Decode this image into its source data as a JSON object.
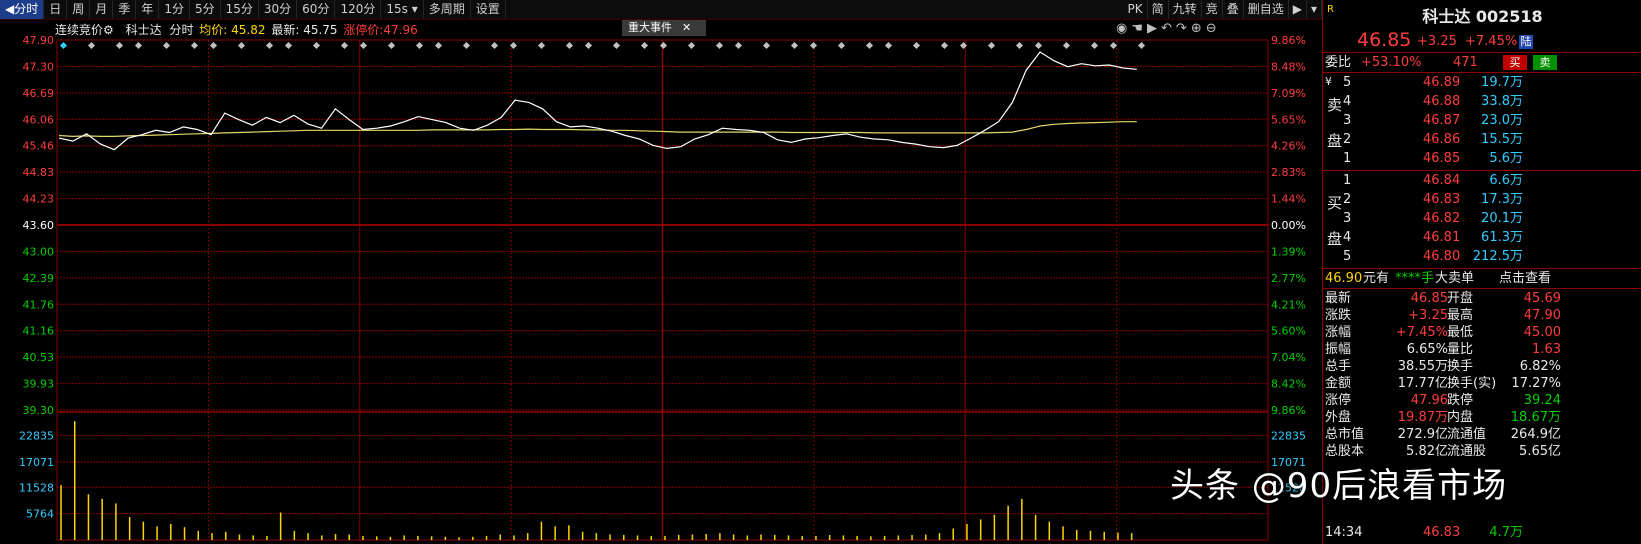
{
  "toolbar": {
    "periods": [
      "分时",
      "日",
      "周",
      "月",
      "季",
      "年",
      "1分",
      "5分",
      "15分",
      "30分",
      "60分",
      "120分",
      "15s",
      "多周期",
      "设置"
    ],
    "right_items": [
      "PK",
      "简",
      "九转",
      "竞",
      "叠",
      "删自选"
    ]
  },
  "header": {
    "auction_label": "连续竞价",
    "name": "科士达",
    "mode": "分时",
    "avg_text": "均价: 45.82",
    "last_text": "最新: 45.75",
    "limit_text": "涨停价:47.96",
    "event_label": "重大事件"
  },
  "axes": {
    "left_prices": [
      "47.90",
      "47.30",
      "46.69",
      "46.06",
      "45.46",
      "44.83",
      "44.23",
      "43.60",
      "43.00",
      "42.39",
      "41.76",
      "41.16",
      "40.53",
      "39.93",
      "39.30"
    ],
    "right_pcts": [
      "9.86%",
      "8.48%",
      "7.09%",
      "5.65%",
      "4.26%",
      "2.83%",
      "1.44%",
      "0.00%",
      "1.39%",
      "2.77%",
      "4.21%",
      "5.60%",
      "7.04%",
      "8.42%",
      "9.86%"
    ],
    "vol_left": [
      "22835",
      "17071",
      "11528",
      "5764"
    ],
    "vol_right": [
      "22835",
      "17071",
      "11528"
    ]
  },
  "chart_data": {
    "type": "line",
    "title": "",
    "prev_close": 43.6,
    "ylim": [
      39.3,
      47.9
    ],
    "series": [
      {
        "values": [
          45.62,
          45.55,
          45.72,
          45.48,
          45.35,
          45.62,
          45.7,
          45.8,
          45.75,
          45.88,
          45.82,
          45.7,
          46.2,
          46.05,
          45.92,
          46.1,
          45.98,
          46.15,
          45.95,
          45.85,
          46.3,
          46.05,
          45.82,
          45.85,
          45.9,
          46.0,
          46.12,
          46.05,
          45.98,
          45.85,
          45.8,
          45.92,
          46.1,
          46.5,
          46.45,
          46.3,
          46.0,
          45.88,
          45.9,
          45.85,
          45.78,
          45.68,
          45.6,
          45.45,
          45.38,
          45.42,
          45.6,
          45.7,
          45.85,
          45.82,
          45.8,
          45.75,
          45.58,
          45.52,
          45.6,
          45.63,
          45.68,
          45.72,
          45.64,
          45.6,
          45.58,
          45.52,
          45.48,
          45.42,
          45.4,
          45.45,
          45.62,
          45.8,
          46.0,
          46.45,
          47.2,
          47.62,
          47.42,
          47.28,
          47.35,
          47.3,
          47.32,
          47.25,
          47.22
        ]
      },
      {
        "values": [
          45.68,
          45.66,
          45.67,
          45.66,
          45.66,
          45.67,
          45.68,
          45.69,
          45.7,
          45.71,
          45.72,
          45.73,
          45.74,
          45.75,
          45.76,
          45.77,
          45.78,
          45.79,
          45.8,
          45.8,
          45.8,
          45.8,
          45.8,
          45.8,
          45.8,
          45.8,
          45.8,
          45.81,
          45.81,
          45.81,
          45.81,
          45.81,
          45.82,
          45.82,
          45.83,
          45.82,
          45.82,
          45.82,
          45.81,
          45.81,
          45.8,
          45.8,
          45.79,
          45.78,
          45.77,
          45.76,
          45.76,
          45.76,
          45.76,
          45.76,
          45.76,
          45.76,
          45.76,
          45.75,
          45.75,
          45.75,
          45.75,
          45.75,
          45.75,
          45.74,
          45.74,
          45.74,
          45.74,
          45.74,
          45.74,
          45.74,
          45.74,
          45.74,
          45.75,
          45.76,
          45.82,
          45.9,
          45.94,
          45.96,
          45.97,
          45.98,
          45.99,
          46.0,
          46.0
        ]
      }
    ],
    "volume": [
      12000,
      26000,
      10000,
      9000,
      8000,
      5000,
      4000,
      3000,
      3500,
      2800,
      2000,
      1500,
      1800,
      1200,
      1000,
      900,
      6000,
      2000,
      1500,
      1000,
      1300,
      1200,
      900,
      800,
      700,
      1000,
      900,
      800,
      700,
      600,
      700,
      900,
      1200,
      1000,
      1500,
      4000,
      3000,
      3200,
      1800,
      1500,
      1200,
      1100,
      1000,
      900,
      900,
      1100,
      1200,
      1300,
      1500,
      1200,
      1000,
      1200,
      1100,
      1000,
      900,
      900,
      1100,
      1000,
      900,
      800,
      900,
      1000,
      1100,
      1200,
      1500,
      2500,
      3500,
      4500,
      5500,
      7500,
      9000,
      5500,
      4000,
      3000,
      2200,
      2000,
      1800,
      1600,
      1500
    ],
    "vol_ylim": [
      0,
      28000
    ]
  },
  "quote": {
    "title": "科士达 002518",
    "price": "46.85",
    "change": "+3.25",
    "change_pct": "+7.45%",
    "market": "陆",
    "committee_label": "委比",
    "committee_ratio": "+53.10%",
    "committee_diff": "471",
    "buy_btn": "买",
    "sell_btn": "卖",
    "sell_label": [
      "卖",
      "盘"
    ],
    "buy_label": [
      "买",
      "盘"
    ],
    "asks": [
      {
        "lvl": "5",
        "price": "46.89",
        "vol": "19.7万"
      },
      {
        "lvl": "4",
        "price": "46.88",
        "vol": "33.8万"
      },
      {
        "lvl": "3",
        "price": "46.87",
        "vol": "23.0万"
      },
      {
        "lvl": "2",
        "price": "46.86",
        "vol": "15.5万"
      },
      {
        "lvl": "1",
        "price": "46.85",
        "vol": "5.6万"
      }
    ],
    "bids": [
      {
        "lvl": "1",
        "price": "46.84",
        "vol": "6.6万"
      },
      {
        "lvl": "2",
        "price": "46.83",
        "vol": "17.3万"
      },
      {
        "lvl": "3",
        "price": "46.82",
        "vol": "20.1万"
      },
      {
        "lvl": "4",
        "price": "46.81",
        "vol": "61.3万"
      },
      {
        "lvl": "5",
        "price": "46.80",
        "vol": "212.5万"
      }
    ],
    "bigorder": {
      "price": "46.90",
      "unit": "元有",
      "stars": "****手",
      "label": "大卖单",
      "link": "点击查看"
    },
    "stats": [
      {
        "l1": "最新",
        "v1": "46.85",
        "c1": "red",
        "l2": "开盘",
        "v2": "45.69",
        "c2": "red"
      },
      {
        "l1": "涨跌",
        "v1": "+3.25",
        "c1": "red",
        "l2": "最高",
        "v2": "47.90",
        "c2": "red"
      },
      {
        "l1": "涨幅",
        "v1": "+7.45%",
        "c1": "red",
        "l2": "最低",
        "v2": "45.00",
        "c2": "red"
      },
      {
        "l1": "振幅",
        "v1": "6.65%",
        "c1": "white",
        "l2": "量比",
        "v2": "1.63",
        "c2": "red"
      },
      {
        "l1": "总手",
        "v1": "38.55万",
        "c1": "white",
        "l2": "换手",
        "v2": "6.82%",
        "c2": "white"
      },
      {
        "l1": "金额",
        "v1": "17.77亿",
        "c1": "white",
        "l2": "换手(实)",
        "v2": "17.27%",
        "c2": "white"
      },
      {
        "l1": "涨停",
        "v1": "47.96",
        "c1": "red",
        "l2": "跌停",
        "v2": "39.24",
        "c2": "green"
      },
      {
        "l1": "外盘",
        "v1": "19.87万",
        "c1": "red",
        "l2": "内盘",
        "v2": "18.67万",
        "c2": "green"
      },
      {
        "l1": "总市值",
        "v1": "272.9亿",
        "c1": "white",
        "l2": "流通值",
        "v2": "264.9亿",
        "c2": "white"
      },
      {
        "l1": "总股本",
        "v1": "5.82亿",
        "c1": "white",
        "l2": "流通股",
        "v2": "5.65亿",
        "c2": "white"
      }
    ],
    "last_tick": {
      "time": "14:34",
      "price": "46.83",
      "vol": "4.7万"
    }
  },
  "watermark": "头条 @90后浪看市场",
  "colors": {
    "grid": "#8b0000",
    "up": "#ff3d3d",
    "down": "#00d000",
    "price_line": "#ffffff",
    "avg_line": "#e6d76a",
    "volume": "#ffd700",
    "accent": "#33ccff"
  }
}
